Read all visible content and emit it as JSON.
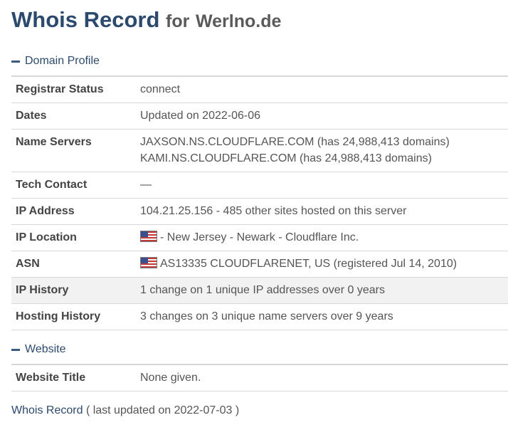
{
  "header": {
    "title": "Whois Record",
    "for_text": "for",
    "domain": "Werlno.de"
  },
  "sections": {
    "domain_profile": {
      "label": "Domain Profile"
    },
    "website": {
      "label": "Website"
    }
  },
  "profile": {
    "registrar_status": {
      "label": "Registrar Status",
      "value": "connect"
    },
    "dates": {
      "label": "Dates",
      "value": "Updated on 2022-06-06"
    },
    "name_servers": {
      "label": "Name Servers",
      "line1": "JAXSON.NS.CLOUDFLARE.COM (has 24,988,413 domains)",
      "line2": "KAMI.NS.CLOUDFLARE.COM (has 24,988,413 domains)"
    },
    "tech_contact": {
      "label": "Tech Contact",
      "value": "—"
    },
    "ip_address": {
      "label": "IP Address",
      "value": "104.21.25.156 - 485 other sites hosted on this server"
    },
    "ip_location": {
      "label": "IP Location",
      "value": "- New Jersey - Newark - Cloudflare Inc."
    },
    "asn": {
      "label": "ASN",
      "value": "AS13335 CLOUDFLARENET, US (registered Jul 14, 2010)"
    },
    "ip_history": {
      "label": "IP History",
      "value": "1 change on 1 unique IP addresses over 0 years"
    },
    "hosting_history": {
      "label": "Hosting History",
      "value": "3 changes on 3 unique name servers over 9 years"
    }
  },
  "website": {
    "website_title": {
      "label": "Website Title",
      "value": "None given."
    }
  },
  "footer": {
    "link": "Whois Record",
    "updated": "( last updated on 2022-07-03 )"
  },
  "colors": {
    "heading": "#2c4a6e",
    "shaded_row": "#f2f2f2",
    "border": "#d8d8d8"
  },
  "icons": {
    "flag": "us-flag-icon",
    "collapse": "minus-icon"
  }
}
